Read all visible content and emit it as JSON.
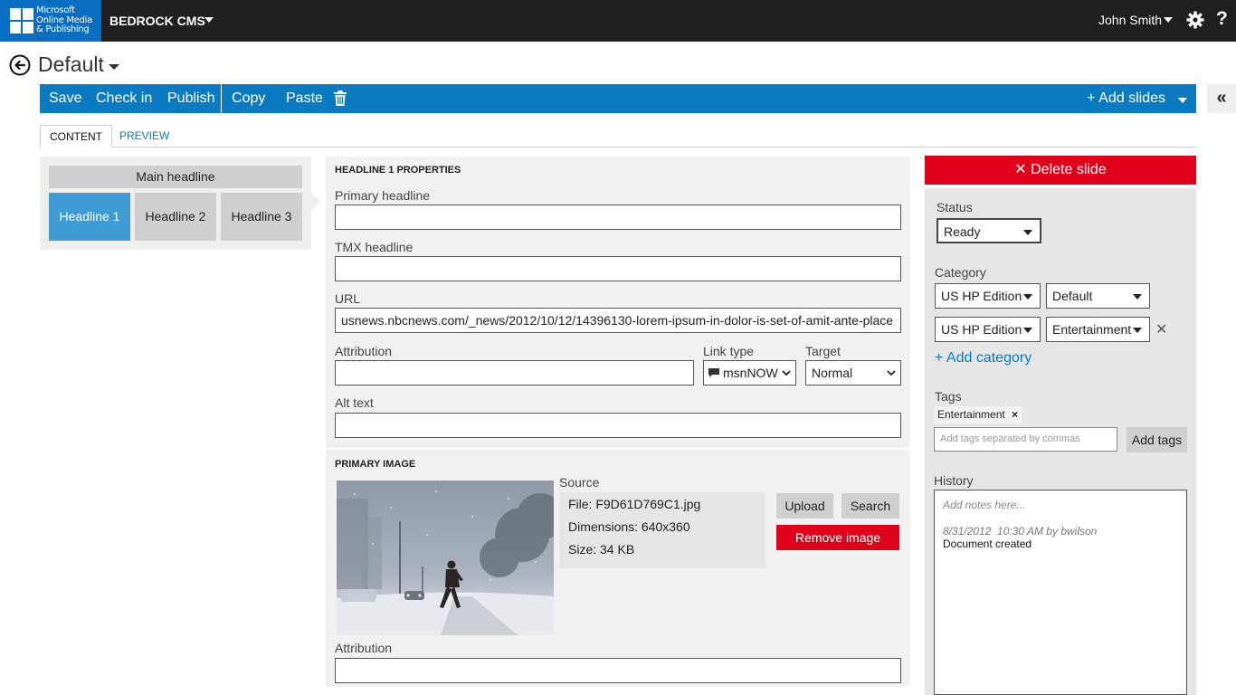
{
  "topbar": {
    "logo_lines": [
      "Microsoft",
      "Online Media",
      "& Publishing"
    ],
    "app_title": "BEDROCK CMS",
    "user_name": "John Smith",
    "help_label": "?"
  },
  "document": {
    "title": "Default"
  },
  "toolbar": {
    "save": "Save",
    "check_in": "Check in",
    "publish": "Publish",
    "copy": "Copy",
    "paste": "Paste",
    "add_slides": "+ Add slides",
    "collapse": "«"
  },
  "tabs": {
    "content": "CONTENT",
    "preview": "PREVIEW"
  },
  "slides": {
    "main_headline": "Main headline",
    "headlines": [
      "Headline 1",
      "Headline 2",
      "Headline 3"
    ],
    "selected": 0
  },
  "properties": {
    "section_title": "HEADLINE 1 PROPERTIES",
    "primary_headline_label": "Primary headline",
    "primary_headline_value": "",
    "tmx_headline_label": "TMX headline",
    "tmx_headline_value": "",
    "url_label": "URL",
    "url_value": "usnews.nbcnews.com/_news/2012/10/12/14396130-lorem-ipsum-in-dolor-is-set-of-amit-ante-place",
    "attribution_label": "Attribution",
    "attribution_value": "",
    "link_type_label": "Link type",
    "link_type_value": "msnNOW",
    "target_label": "Target",
    "target_value": "Normal",
    "alt_text_label": "Alt text",
    "alt_text_value": ""
  },
  "primary_image": {
    "section_title": "PRIMARY IMAGE",
    "source_label": "Source",
    "file": "File: F9D61D769C1.jpg",
    "dimensions": "Dimensions: 640x360",
    "size": "Size: 34 KB",
    "upload": "Upload",
    "search": "Search",
    "remove": "Remove image",
    "attribution_label": "Attribution",
    "attribution_value": ""
  },
  "right_panel": {
    "delete_slide": "✕ Delete slide",
    "status_label": "Status",
    "status_value": "Ready",
    "category_label": "Category",
    "category_rows": [
      {
        "edition": "US HP Edition",
        "section": "Default"
      },
      {
        "edition": "US HP Edition",
        "section": "Entertainment"
      }
    ],
    "remove_category": "✕",
    "add_category": "+ Add category",
    "tags_label": "Tags",
    "tags": [
      "Entertainment"
    ],
    "tag_remove": "×",
    "tags_placeholder": "Add tags separated by commas",
    "add_tags": "Add tags",
    "history_label": "History",
    "notes_placeholder": "Add notes here...",
    "history_entry_meta": "8/31/2012  10:30 AM by bwilson",
    "history_entry_text": "Document created"
  },
  "colors": {
    "toolbar_blue": "#0b7bc1",
    "selected_slide": "#3e9bd3",
    "danger_red": "#e0001b",
    "topbar_dark": "#1f1f1f"
  }
}
